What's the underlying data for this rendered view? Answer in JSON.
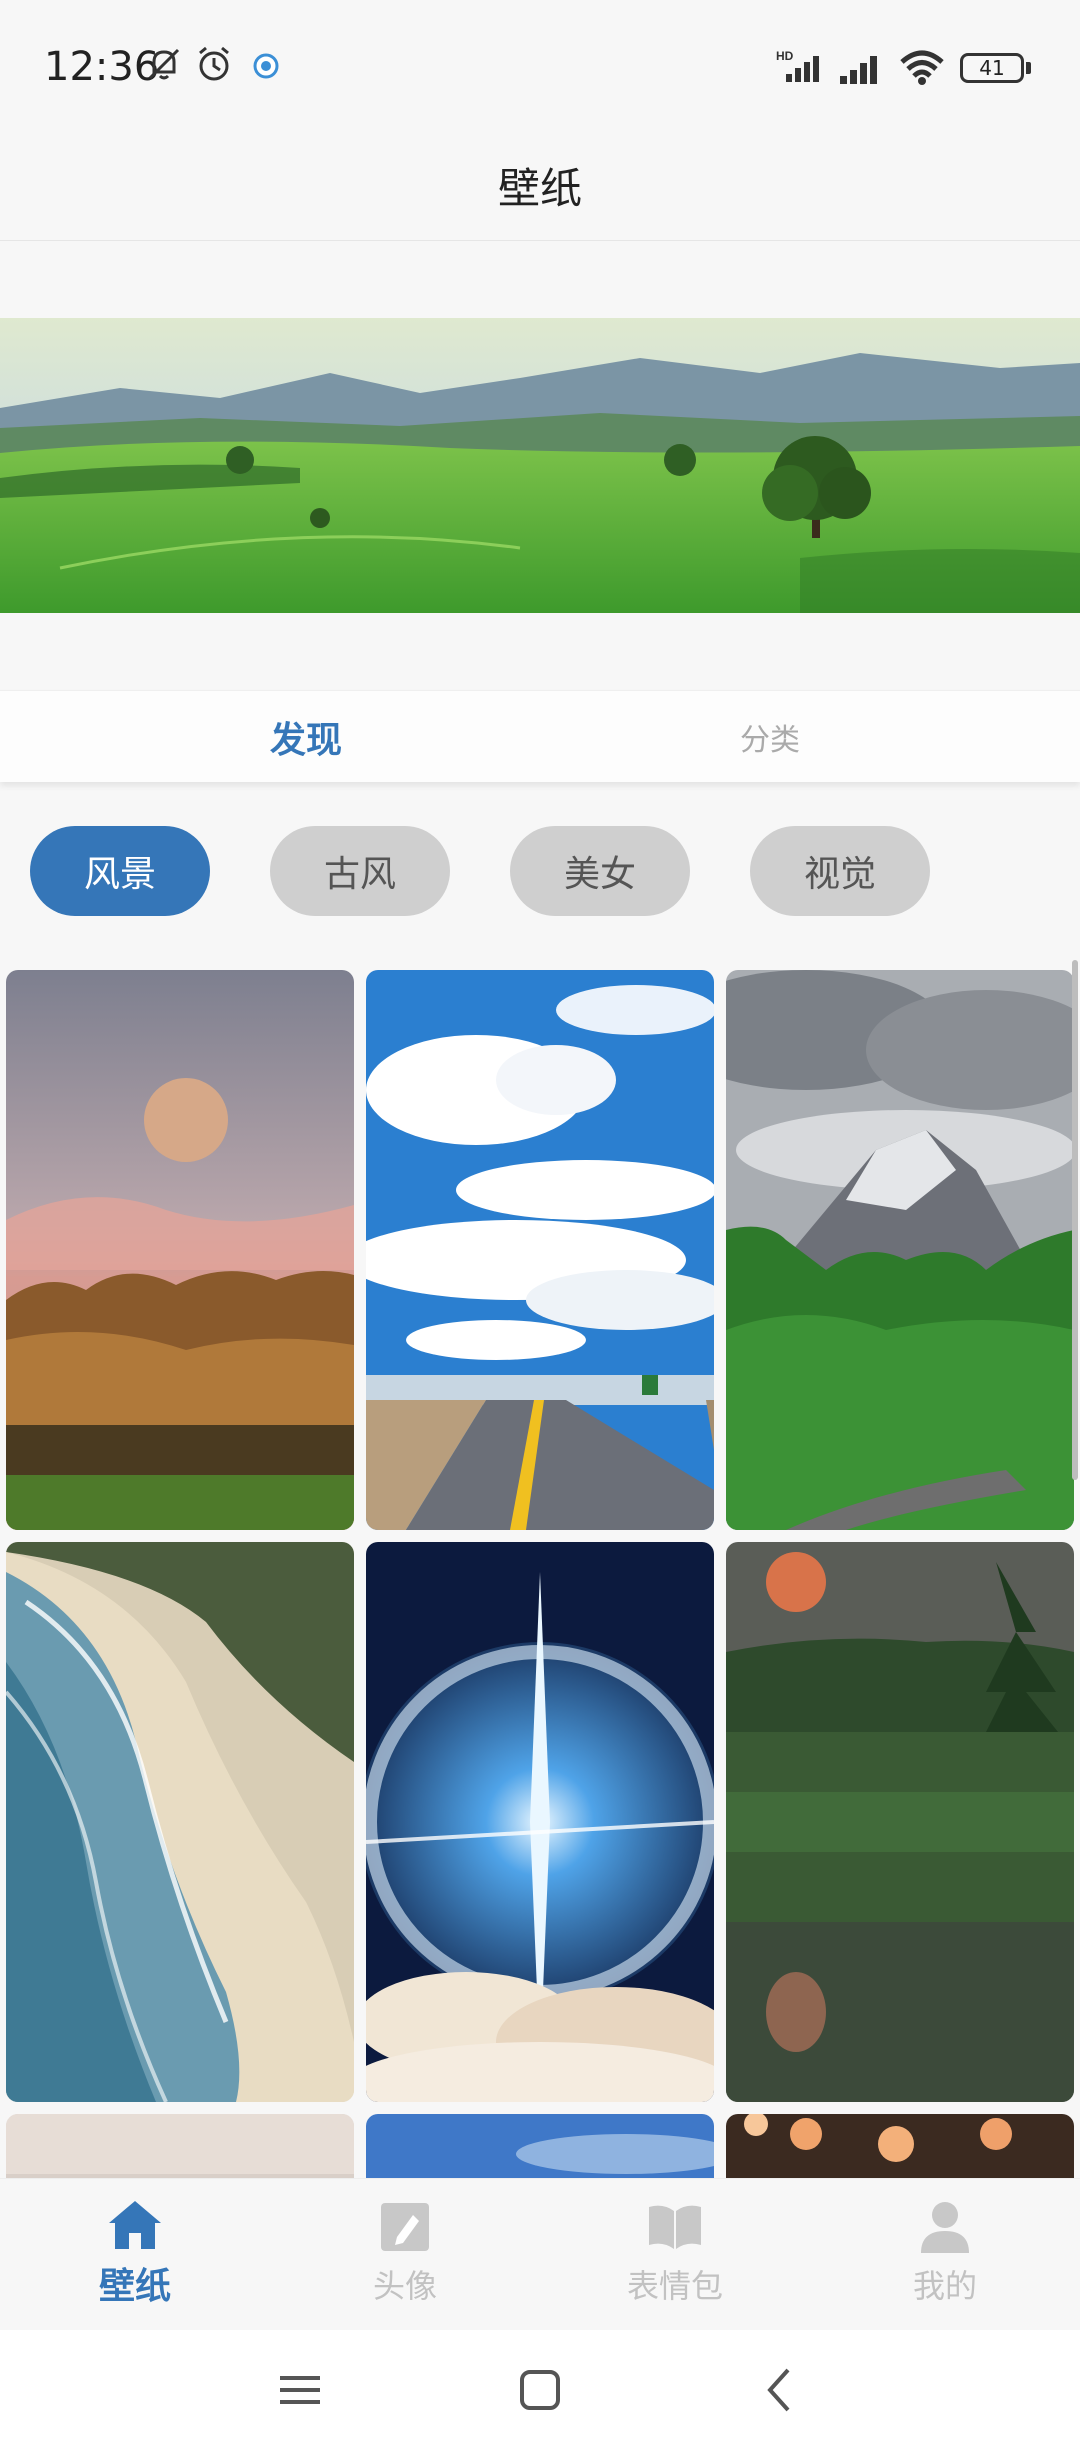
{
  "status_bar": {
    "time": "12:36",
    "battery": "41",
    "icons": [
      "mute-bell-icon",
      "alarm-icon",
      "app-notification-icon",
      "hd-signal-icon",
      "signal-icon",
      "wifi-icon",
      "battery-icon"
    ]
  },
  "header": {
    "title": "壁纸"
  },
  "tabs": [
    {
      "label": "发现",
      "active": true
    },
    {
      "label": "分类",
      "active": false
    }
  ],
  "chips": [
    {
      "label": "风景",
      "active": true
    },
    {
      "label": "古风",
      "active": false
    },
    {
      "label": "美女",
      "active": false
    },
    {
      "label": "视觉",
      "active": false
    }
  ],
  "bottom_nav": [
    {
      "label": "壁纸",
      "icon": "home-icon",
      "active": true
    },
    {
      "label": "头像",
      "icon": "edit-photo-icon",
      "active": false
    },
    {
      "label": "表情包",
      "icon": "book-icon",
      "active": false
    },
    {
      "label": "我的",
      "icon": "person-icon",
      "active": false
    }
  ],
  "colors": {
    "accent": "#3576b8",
    "chip_inactive": "#cfcfcf",
    "nav_inactive": "#c2c2c2"
  }
}
